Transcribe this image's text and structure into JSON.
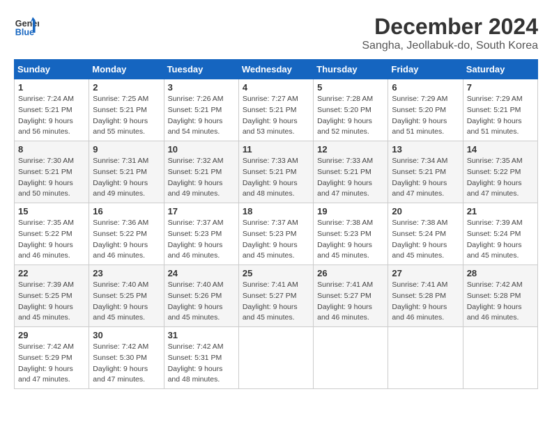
{
  "logo": {
    "line1": "General",
    "line2": "Blue"
  },
  "title": "December 2024",
  "subtitle": "Sangha, Jeollabuk-do, South Korea",
  "weekdays": [
    "Sunday",
    "Monday",
    "Tuesday",
    "Wednesday",
    "Thursday",
    "Friday",
    "Saturday"
  ],
  "weeks": [
    [
      {
        "day": "1",
        "sunrise": "7:24 AM",
        "sunset": "5:21 PM",
        "daylight": "9 hours and 56 minutes."
      },
      {
        "day": "2",
        "sunrise": "7:25 AM",
        "sunset": "5:21 PM",
        "daylight": "9 hours and 55 minutes."
      },
      {
        "day": "3",
        "sunrise": "7:26 AM",
        "sunset": "5:21 PM",
        "daylight": "9 hours and 54 minutes."
      },
      {
        "day": "4",
        "sunrise": "7:27 AM",
        "sunset": "5:21 PM",
        "daylight": "9 hours and 53 minutes."
      },
      {
        "day": "5",
        "sunrise": "7:28 AM",
        "sunset": "5:20 PM",
        "daylight": "9 hours and 52 minutes."
      },
      {
        "day": "6",
        "sunrise": "7:29 AM",
        "sunset": "5:20 PM",
        "daylight": "9 hours and 51 minutes."
      },
      {
        "day": "7",
        "sunrise": "7:29 AM",
        "sunset": "5:21 PM",
        "daylight": "9 hours and 51 minutes."
      }
    ],
    [
      {
        "day": "8",
        "sunrise": "7:30 AM",
        "sunset": "5:21 PM",
        "daylight": "9 hours and 50 minutes."
      },
      {
        "day": "9",
        "sunrise": "7:31 AM",
        "sunset": "5:21 PM",
        "daylight": "9 hours and 49 minutes."
      },
      {
        "day": "10",
        "sunrise": "7:32 AM",
        "sunset": "5:21 PM",
        "daylight": "9 hours and 49 minutes."
      },
      {
        "day": "11",
        "sunrise": "7:33 AM",
        "sunset": "5:21 PM",
        "daylight": "9 hours and 48 minutes."
      },
      {
        "day": "12",
        "sunrise": "7:33 AM",
        "sunset": "5:21 PM",
        "daylight": "9 hours and 47 minutes."
      },
      {
        "day": "13",
        "sunrise": "7:34 AM",
        "sunset": "5:21 PM",
        "daylight": "9 hours and 47 minutes."
      },
      {
        "day": "14",
        "sunrise": "7:35 AM",
        "sunset": "5:22 PM",
        "daylight": "9 hours and 47 minutes."
      }
    ],
    [
      {
        "day": "15",
        "sunrise": "7:35 AM",
        "sunset": "5:22 PM",
        "daylight": "9 hours and 46 minutes."
      },
      {
        "day": "16",
        "sunrise": "7:36 AM",
        "sunset": "5:22 PM",
        "daylight": "9 hours and 46 minutes."
      },
      {
        "day": "17",
        "sunrise": "7:37 AM",
        "sunset": "5:23 PM",
        "daylight": "9 hours and 46 minutes."
      },
      {
        "day": "18",
        "sunrise": "7:37 AM",
        "sunset": "5:23 PM",
        "daylight": "9 hours and 45 minutes."
      },
      {
        "day": "19",
        "sunrise": "7:38 AM",
        "sunset": "5:23 PM",
        "daylight": "9 hours and 45 minutes."
      },
      {
        "day": "20",
        "sunrise": "7:38 AM",
        "sunset": "5:24 PM",
        "daylight": "9 hours and 45 minutes."
      },
      {
        "day": "21",
        "sunrise": "7:39 AM",
        "sunset": "5:24 PM",
        "daylight": "9 hours and 45 minutes."
      }
    ],
    [
      {
        "day": "22",
        "sunrise": "7:39 AM",
        "sunset": "5:25 PM",
        "daylight": "9 hours and 45 minutes."
      },
      {
        "day": "23",
        "sunrise": "7:40 AM",
        "sunset": "5:25 PM",
        "daylight": "9 hours and 45 minutes."
      },
      {
        "day": "24",
        "sunrise": "7:40 AM",
        "sunset": "5:26 PM",
        "daylight": "9 hours and 45 minutes."
      },
      {
        "day": "25",
        "sunrise": "7:41 AM",
        "sunset": "5:27 PM",
        "daylight": "9 hours and 45 minutes."
      },
      {
        "day": "26",
        "sunrise": "7:41 AM",
        "sunset": "5:27 PM",
        "daylight": "9 hours and 46 minutes."
      },
      {
        "day": "27",
        "sunrise": "7:41 AM",
        "sunset": "5:28 PM",
        "daylight": "9 hours and 46 minutes."
      },
      {
        "day": "28",
        "sunrise": "7:42 AM",
        "sunset": "5:28 PM",
        "daylight": "9 hours and 46 minutes."
      }
    ],
    [
      {
        "day": "29",
        "sunrise": "7:42 AM",
        "sunset": "5:29 PM",
        "daylight": "9 hours and 47 minutes."
      },
      {
        "day": "30",
        "sunrise": "7:42 AM",
        "sunset": "5:30 PM",
        "daylight": "9 hours and 47 minutes."
      },
      {
        "day": "31",
        "sunrise": "7:42 AM",
        "sunset": "5:31 PM",
        "daylight": "9 hours and 48 minutes."
      },
      null,
      null,
      null,
      null
    ]
  ]
}
